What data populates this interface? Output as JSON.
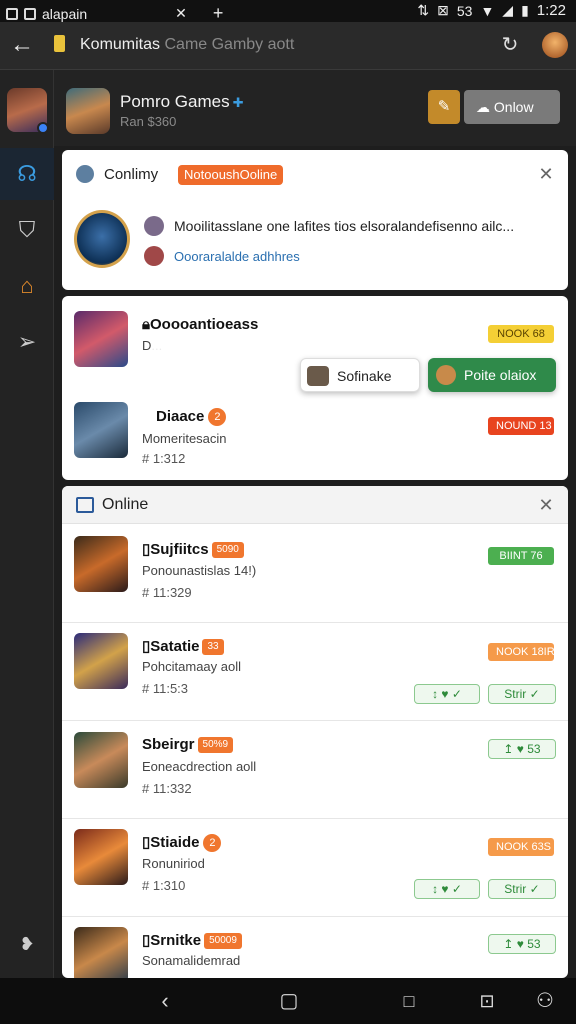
{
  "status": {
    "app_label": "alapain",
    "time": "1:22",
    "battery_text": "53"
  },
  "browser": {
    "url_main": "Komumitas",
    "url_dim": "Came Gamby aott"
  },
  "header": {
    "title": "Pomro Games",
    "subtitle": "Ran $360",
    "online_button": "Onlow"
  },
  "community": {
    "title": "Conlimy",
    "badge": "NotooushOoline",
    "line1": "Mooilitasslane one lafites tios elsoralandefisenno ailc...",
    "line2": "Oooraralalde adhhres"
  },
  "requests": [
    {
      "name": "Ooooantioeass",
      "sub": "D...",
      "id": "",
      "pill": "NOOK 68",
      "pill_color": "yellow"
    },
    {
      "name": "Diaace",
      "badge": "2",
      "sub": "Momeritesacin",
      "id": "# 1:312",
      "pill": "NOUND 13",
      "pill_color": "red"
    }
  ],
  "popup": {
    "secondary": "Sofinake",
    "primary": "Poite olaiox"
  },
  "online": {
    "title": "Online",
    "rows": [
      {
        "name": "Sujfiitcs",
        "badge": "5090",
        "sub": "Ponounastislas 14!)",
        "id": "# 11:329",
        "pill": "BIINT 76",
        "pill_color": "green",
        "actions": []
      },
      {
        "name": "Satatie",
        "badge": "33",
        "sub": "Pohcitamaay aoll",
        "id": "# 11:5:3",
        "pill": "NOOK 18IR",
        "pill_color": "orange",
        "actions": [
          "↕ ♥ ✓",
          "Strir ✓"
        ]
      },
      {
        "name": "Sbeirgr",
        "badge": "50%9",
        "sub": "Eoneacdrection aoll",
        "id": "# 11:332",
        "pill": "",
        "pill_color": "",
        "actions": [
          "↥ ♥  53"
        ]
      },
      {
        "name": "Stiaide",
        "badge": "2",
        "sub": "Ronuniriod",
        "id": "# 1:310",
        "pill": "NOOK 63S",
        "pill_color": "orange",
        "actions": [
          "↕ ♥ ✓",
          "Strir ✓"
        ]
      },
      {
        "name": "Srnitke",
        "badge": "50009",
        "sub": "Sonamalidemrad",
        "id": "",
        "pill": "",
        "pill_color": "",
        "actions": [
          "↥ ♥  53"
        ]
      }
    ]
  }
}
